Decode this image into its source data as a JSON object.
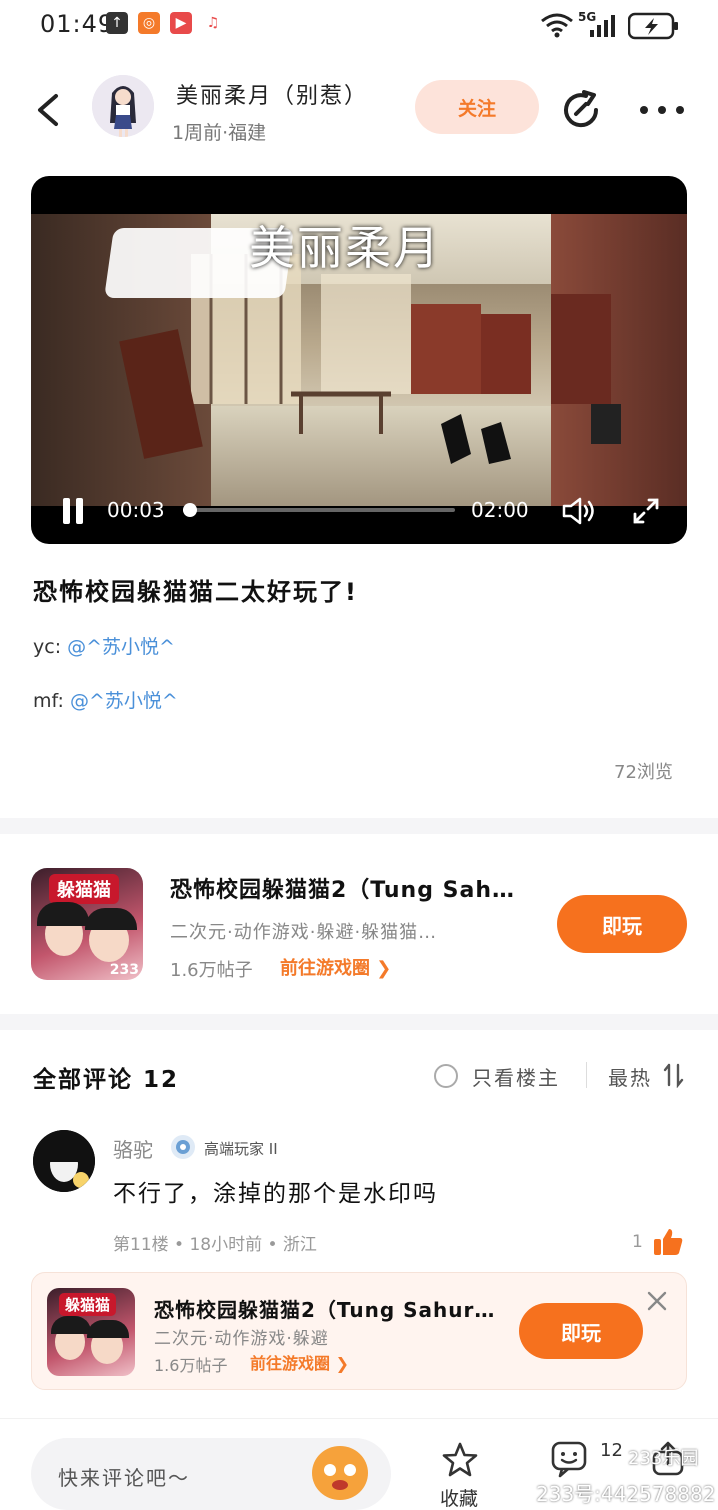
{
  "status_bar": {
    "time": "01:49",
    "network": "5G",
    "icons": [
      "upload-icon",
      "app-icon",
      "video-icon",
      "music-icon",
      "wifi-icon",
      "signal-icon",
      "battery-icon"
    ]
  },
  "header": {
    "user_name": "美丽柔月（别惹）",
    "meta": "1周前·福建",
    "follow_label": "关注"
  },
  "video": {
    "overlay_title": "美丽柔月",
    "current_time": "00:03",
    "total_time": "02:00",
    "progress": 0.025
  },
  "post": {
    "title": "恐怖校园躲猫猫二太好玩了!",
    "lines": [
      {
        "prefix": "yc: ",
        "mention": "@^苏小悦^"
      },
      {
        "prefix": "mf: ",
        "mention": "@^苏小悦^"
      }
    ],
    "views": "72浏览"
  },
  "game_card": {
    "icon_tag": "躲猫猫",
    "icon_sub": "233",
    "name": "恐怖校园躲猫猫2（Tung Sah…",
    "tags": "二次元·动作游戏·躲避·躲猫猫…",
    "posts": "1.6万帖子",
    "link": "前往游戏圈 ❯",
    "play_label": "即玩"
  },
  "comments": {
    "header": "全部评论 12",
    "only_op_label": "只看楼主",
    "sort_label": "最热",
    "items": [
      {
        "name": "骆驼",
        "level": "高端玩家 II",
        "text": "不行了，涂掉的那个是水印吗",
        "meta": "第11楼 • 18小时前 • 浙江",
        "likes": "1"
      }
    ]
  },
  "floating_card": {
    "icon_tag": "躲猫猫",
    "name": "恐怖校园躲猫猫2（Tung Sahur…",
    "tags": "二次元·动作游戏·躲避",
    "posts": "1.6万帖子",
    "link": "前往游戏圈 ❯",
    "play_label": "即玩"
  },
  "bottom_bar": {
    "input_placeholder": "快来评论吧～",
    "fav_label": "收藏",
    "comment_count": "12",
    "watermark": "233号:442578882",
    "watermark_small": "233乐园"
  },
  "colors": {
    "accent": "#f6711e",
    "mention": "#4a90d9",
    "follow_bg": "#fde3da"
  }
}
